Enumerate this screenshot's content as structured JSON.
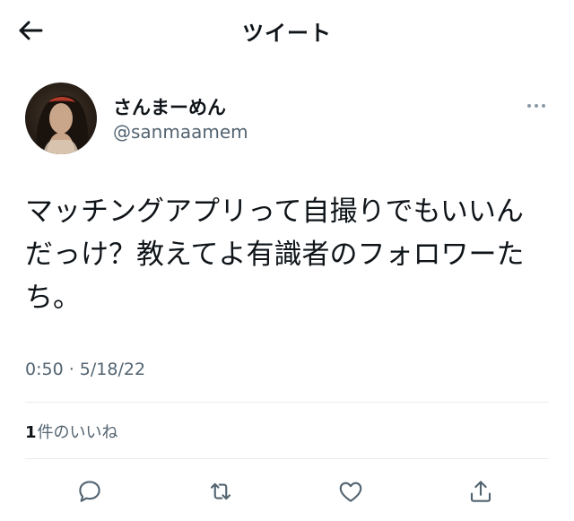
{
  "header": {
    "title": "ツイート",
    "back_icon": "arrow-left-icon"
  },
  "author": {
    "display_name": "さんまーめん",
    "handle": "@sanmaamem",
    "avatar_icon": "avatar-portrait"
  },
  "tweet": {
    "text": "マッチングアプリって自撮りでもいいんだっけ？教えてよ有識者のフォロワーたち。",
    "timestamp": "0:50 · 5/18/22"
  },
  "engagement": {
    "likes_count": "1",
    "likes_label": "件のいいね"
  },
  "actions": {
    "reply_icon": "reply-icon",
    "retweet_icon": "retweet-icon",
    "like_icon": "heart-icon",
    "share_icon": "share-icon"
  },
  "colors": {
    "text_primary": "#0f1419",
    "text_secondary": "#536471",
    "divider": "#e6ecf0"
  }
}
